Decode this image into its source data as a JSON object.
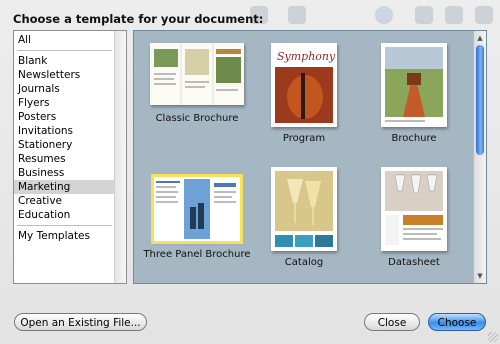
{
  "dialog": {
    "prompt": "Choose a template for your document:"
  },
  "categories": {
    "items": [
      {
        "label": "All",
        "selected": false
      },
      {
        "label": "Blank",
        "selected": false
      },
      {
        "label": "Newsletters",
        "selected": false
      },
      {
        "label": "Journals",
        "selected": false
      },
      {
        "label": "Flyers",
        "selected": false
      },
      {
        "label": "Posters",
        "selected": false
      },
      {
        "label": "Invitations",
        "selected": false
      },
      {
        "label": "Stationery",
        "selected": false
      },
      {
        "label": "Resumes",
        "selected": false
      },
      {
        "label": "Business",
        "selected": false
      },
      {
        "label": "Marketing",
        "selected": true
      },
      {
        "label": "Creative",
        "selected": false
      },
      {
        "label": "Education",
        "selected": false
      }
    ],
    "footer_item": "My Templates"
  },
  "templates": [
    {
      "label": "Classic Brochure",
      "selected": false
    },
    {
      "label": "Program",
      "selected": false,
      "cover_title": "Symphony"
    },
    {
      "label": "Brochure",
      "selected": false
    },
    {
      "label": "Three Panel Brochure",
      "selected": true
    },
    {
      "label": "Catalog",
      "selected": false
    },
    {
      "label": "Datasheet",
      "selected": false
    }
  ],
  "buttons": {
    "open_existing": "Open an Existing File...",
    "close": "Close",
    "choose": "Choose"
  },
  "colors": {
    "gallery_bg": "#a6b7c4",
    "selection_outline": "#f3e25a",
    "default_button": "#3c8ee8",
    "selected_category_bg": "#d4d4d4"
  }
}
